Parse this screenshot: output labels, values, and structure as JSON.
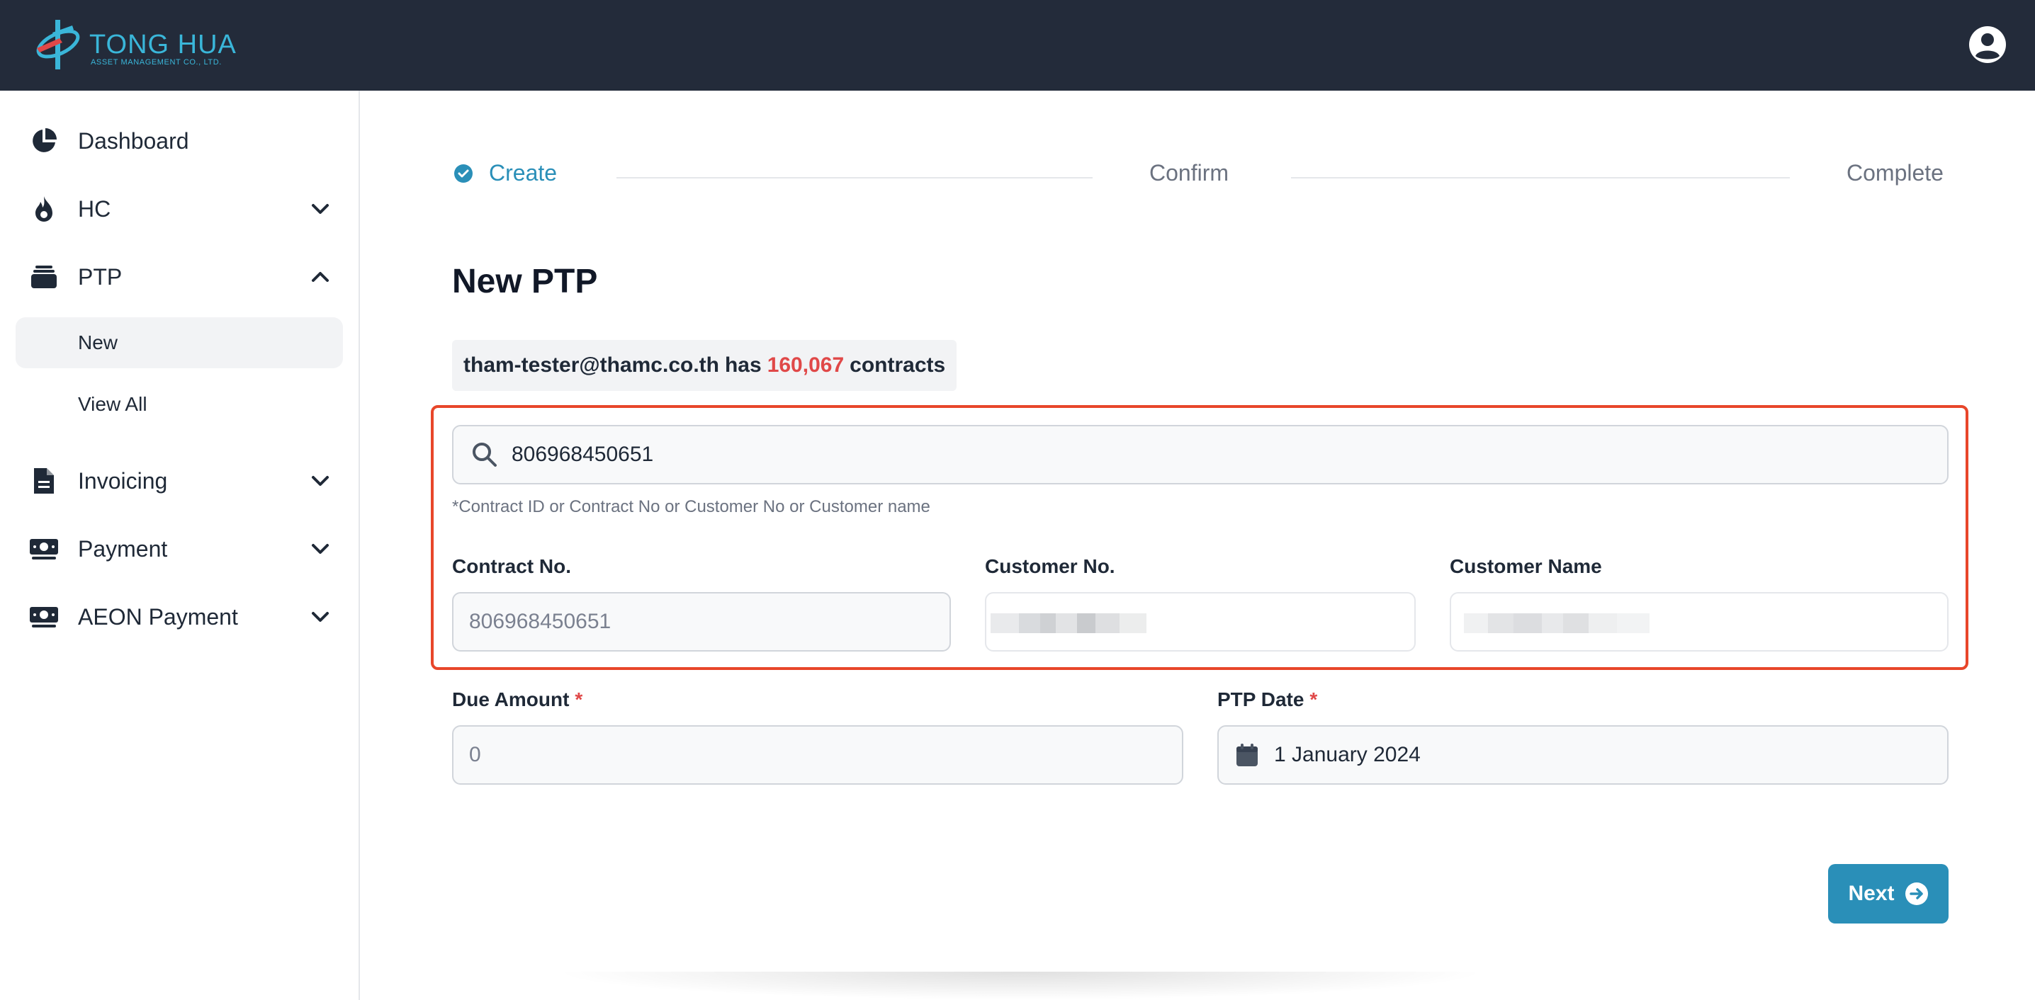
{
  "header": {
    "logo_title": "TONG HUA",
    "logo_subtitle": "ASSET MANAGEMENT CO., LTD.",
    "user_icon": "user-circle-icon"
  },
  "sidebar": {
    "items": [
      {
        "label": "Dashboard",
        "icon": "pie-chart-icon"
      },
      {
        "label": "HC",
        "icon": "fire-icon",
        "chevron": "chevron-down-icon"
      },
      {
        "label": "PTP",
        "icon": "layers-icon",
        "chevron": "chevron-up-icon"
      },
      {
        "label": "Invoicing",
        "icon": "document-icon",
        "chevron": "chevron-down-icon"
      },
      {
        "label": "Payment",
        "icon": "banknote-icon",
        "chevron": "chevron-down-icon"
      },
      {
        "label": "AEON Payment",
        "icon": "banknote-icon",
        "chevron": "chevron-down-icon"
      }
    ],
    "ptp_sub": [
      {
        "label": "New",
        "active": true
      },
      {
        "label": "View All",
        "active": false
      }
    ]
  },
  "stepper": {
    "steps": [
      "Create",
      "Confirm",
      "Complete"
    ],
    "active_color": "#2a8fb8"
  },
  "main": {
    "title": "New PTP",
    "contracts": {
      "user": "tham-tester@thamc.co.th",
      "has": "has",
      "count": "160,067",
      "suffix": "contracts"
    },
    "search": {
      "value": "806968450651",
      "hint": "*Contract ID or Contract No or Customer No or Customer name"
    },
    "fields": {
      "contract_no_label": "Contract No.",
      "contract_no_value": "806968450651",
      "customer_no_label": "Customer No.",
      "customer_name_label": "Customer Name",
      "due_amount_label": "Due Amount",
      "due_amount_value": "0",
      "ptp_date_label": "PTP Date",
      "ptp_date_value": "1 January 2024",
      "required_mark": "*"
    },
    "next_label": "Next",
    "highlight_color": "#e8462a"
  }
}
